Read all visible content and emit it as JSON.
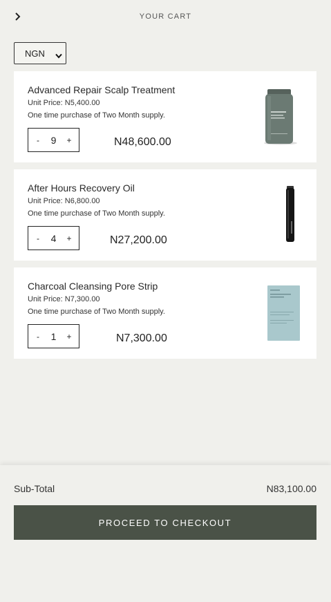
{
  "header": {
    "title": "YOUR CART",
    "back_icon": "chevron-right-icon"
  },
  "currency": {
    "selected": "NGN"
  },
  "cart": {
    "items": [
      {
        "name": "Advanced Repair Scalp Treatment",
        "unit_price": "Unit Price: N5,400.00",
        "supply": "One time purchase of Two Month supply.",
        "qty": "9",
        "minus": "-",
        "plus": "+",
        "total": "N48,600.00",
        "image": "bottle-product-image"
      },
      {
        "name": "After Hours Recovery Oil",
        "unit_price": "Unit Price: N6,800.00",
        "supply": "One time purchase of Two Month supply.",
        "qty": "4",
        "minus": "-",
        "plus": "+",
        "total": "N27,200.00",
        "image": "oil-pen-product-image"
      },
      {
        "name": "Charcoal Cleansing Pore Strip",
        "unit_price": "Unit Price: N7,300.00",
        "supply": "One time purchase of Two Month supply.",
        "qty": "1",
        "minus": "-",
        "plus": "+",
        "total": "N7,300.00",
        "image": "pore-strip-pack-image"
      }
    ]
  },
  "summary": {
    "subtotal_label": "Sub-Total",
    "subtotal_value": "N83,100.00",
    "checkout_label": "PROCEED TO CHECKOUT"
  },
  "colors": {
    "background": "#f0f0ec",
    "card": "#ffffff",
    "checkout_button": "#4a5247"
  }
}
